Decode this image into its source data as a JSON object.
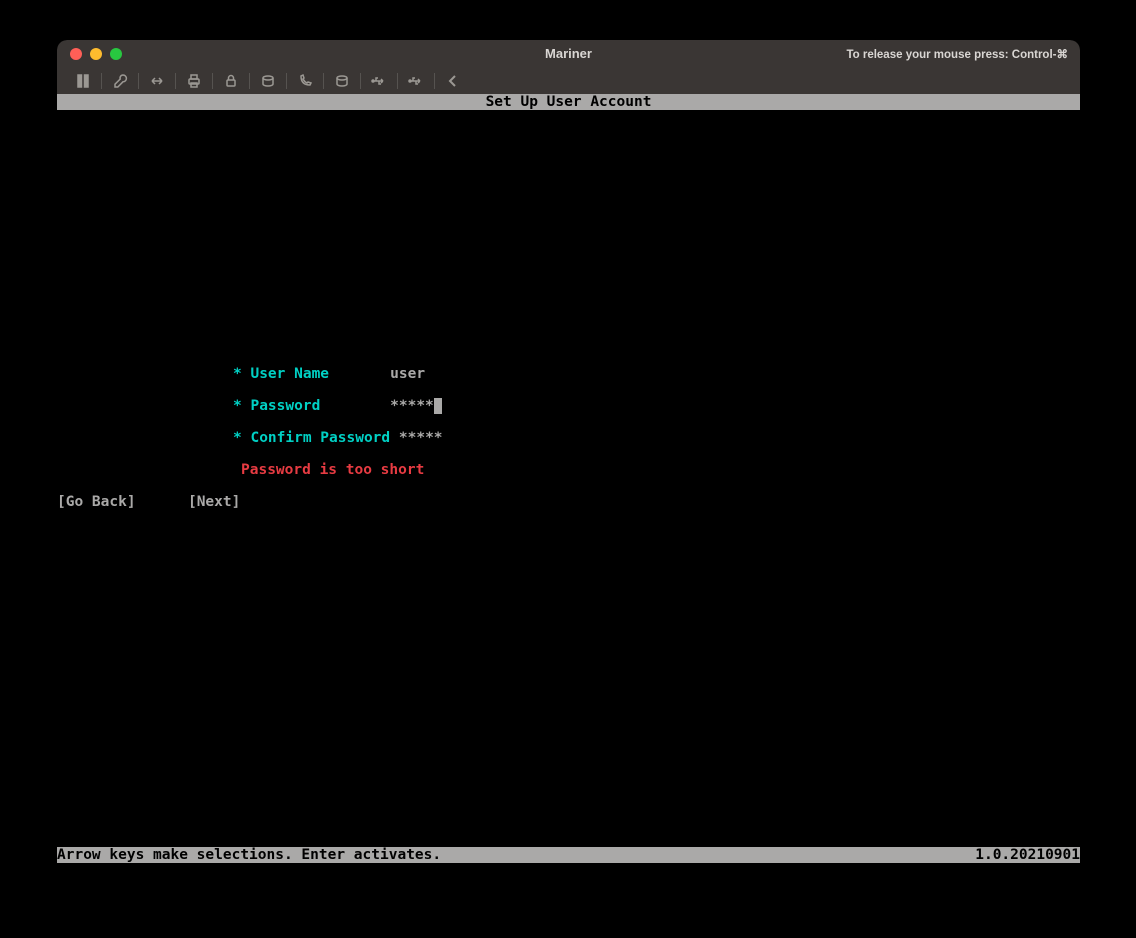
{
  "window": {
    "title": "Mariner",
    "release_hint": "To release your mouse press: Control-⌘"
  },
  "terminal": {
    "header": "Set Up User Account",
    "form": {
      "username_label": "* User Name       ",
      "username_value": "user",
      "password_label": "* Password        ",
      "password_value": "*****",
      "confirm_label": "* Confirm Password ",
      "confirm_value": "*****",
      "error": "Password is too short"
    },
    "buttons": {
      "go_back": "[Go Back]",
      "next": "[Next]",
      "gap": "      "
    },
    "footer": {
      "help": "Arrow keys make selections. Enter activates.",
      "version": "1.0.20210901"
    }
  }
}
